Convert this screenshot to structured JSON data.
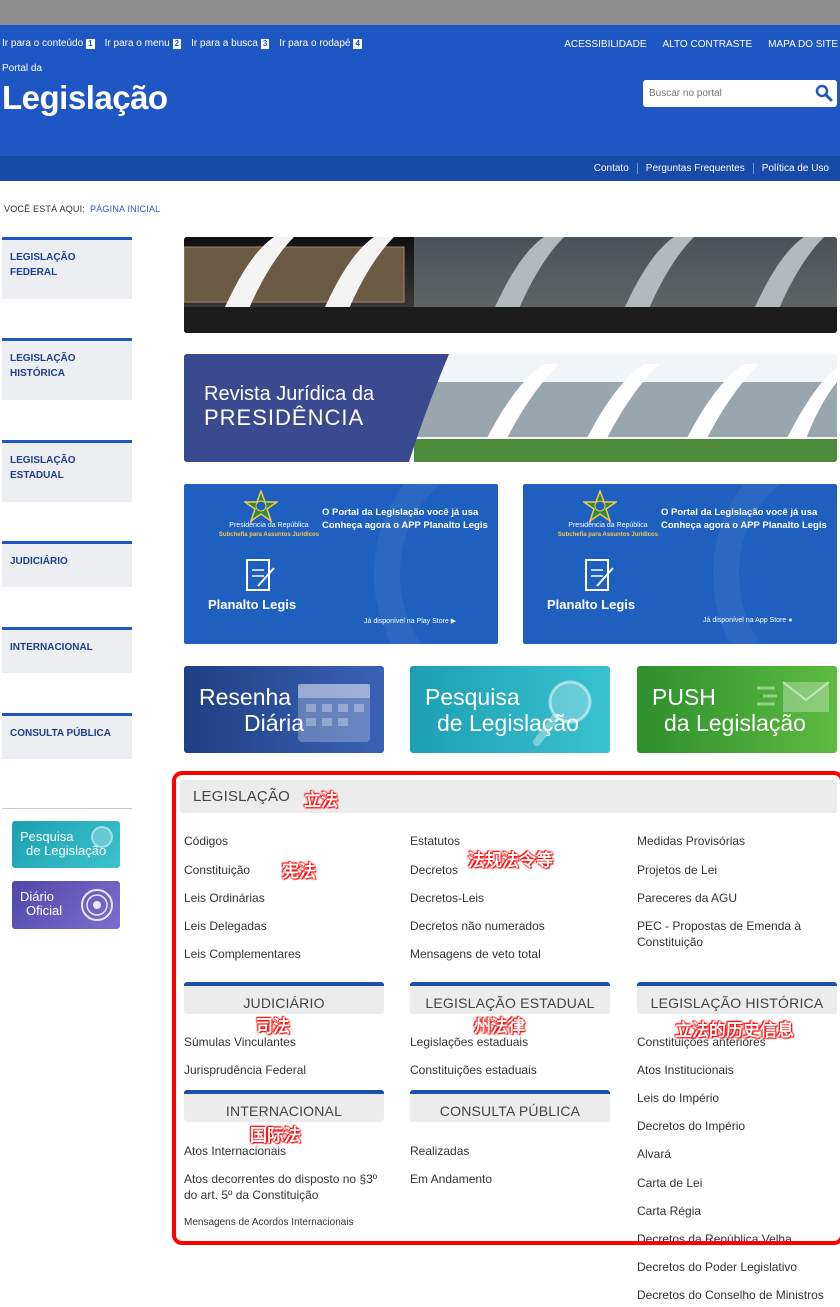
{
  "skip_links": [
    {
      "label": "Ir para o conteúdo",
      "num": "1"
    },
    {
      "label": "Ir para o menu",
      "num": "2"
    },
    {
      "label": "Ir para a busca",
      "num": "3"
    },
    {
      "label": "Ir para o rodapé",
      "num": "4"
    }
  ],
  "top_links": [
    "ACESSIBILIDADE",
    "ALTO CONTRASTE",
    "MAPA DO SITE"
  ],
  "header": {
    "portal_da": "Portal da",
    "title": "Legislação",
    "search_placeholder": "Buscar no portal"
  },
  "subnav": [
    "Contato",
    "Perguntas Frequentes",
    "Política de Uso"
  ],
  "breadcrumb": {
    "label": "VOCÊ ESTÁ AQUI:",
    "current": "PÁGINA INICIAL"
  },
  "left_nav": [
    [
      "LEGISLAÇÃO",
      "FEDERAL"
    ],
    [
      "LEGISLAÇÃO",
      "HISTÓRICA"
    ],
    [
      "LEGISLAÇÃO",
      "ESTADUAL"
    ],
    [
      "JUDICIÁRIO"
    ],
    [
      "INTERNACIONAL"
    ],
    [
      "CONSULTA PÚBLICA"
    ]
  ],
  "small_buttons": {
    "pesquisa": [
      "Pesquisa",
      "de Legislação"
    ],
    "diario": [
      "Diário",
      "Oficial"
    ]
  },
  "revista": {
    "line1": "Revista Jurídica da",
    "line2": "PRESIDÊNCIA"
  },
  "app_cards": [
    {
      "presid": "Presidência da República",
      "sub": "Subchefia para Assuntos Jurídicos",
      "line1": "O Portal da Legislação você já usa",
      "line2": "Conheça agora o APP Planalto Legis",
      "name": "Planalto Legis",
      "store": "Já disponível na Play Store"
    },
    {
      "presid": "Presidência da República",
      "sub": "Subchefia para Assuntos Jurídicos",
      "line1": "O Portal da Legislação você já usa",
      "line2": "Conheça agora o APP Planalto Legis",
      "name": "Planalto Legis",
      "store": "Já disponível na App Store"
    }
  ],
  "tiles": [
    {
      "l1": "Resenha",
      "l2": "Diária"
    },
    {
      "l1": "Pesquisa",
      "l2": "de Legislação"
    },
    {
      "l1": "PUSH",
      "l2": "da Legislação"
    }
  ],
  "legislacao": {
    "heading": "LEGISLAÇÃO",
    "col1": [
      "Códigos",
      "Constituição",
      "Leis Ordinárias",
      "Leis Delegadas",
      "Leis Complementares"
    ],
    "col2": [
      "Estatutos",
      "Decretos",
      "Decretos-Leis",
      "Decretos não numerados",
      "Mensagens de veto total"
    ],
    "col3": [
      "Medidas Provisórias",
      "Projetos de Lei",
      "Pareceres da AGU",
      "PEC - Propostas de Emenda à Constituição"
    ]
  },
  "judiciario": {
    "heading": "JUDICIÁRIO",
    "items": [
      "Súmulas Vinculantes",
      "Jurisprudência Federal"
    ]
  },
  "estadual": {
    "heading": "LEGISLAÇÃO ESTADUAL",
    "items": [
      "Legislações estaduais",
      "Constituições estaduais"
    ]
  },
  "historica": {
    "heading": "LEGISLAÇÃO HISTÓRICA",
    "items": [
      "Constituições anteriores",
      "Atos Institucionais",
      "Leis do Império",
      "Decretos do Império",
      "Alvará",
      "Carta de Lei",
      "Carta Régia",
      "Decretos da República Velha",
      "Decretos do Poder Legislativo",
      "Decretos do Conselho de Ministros"
    ]
  },
  "internacional": {
    "heading": "INTERNACIONAL",
    "items": [
      "Atos Internacionais",
      "Atos decorrentes do disposto no §3º do art. 5º da Constituição",
      "Mensagens de Acordos Internacionais"
    ]
  },
  "consulta": {
    "heading": "CONSULTA PÚBLICA",
    "items": [
      "Realizadas",
      "Em Andamento"
    ]
  },
  "annotations": {
    "legislacao": "立法",
    "constituicao": "宪法",
    "decretos": "法规法令等",
    "judiciario": "司法",
    "estadual": "州法律",
    "historica": "立法的历史信息",
    "internacional": "国际法"
  },
  "colors": {
    "header_blue": "#1e56c4",
    "subnav_blue": "#174aa9",
    "annotation_red": "#ff0000"
  }
}
